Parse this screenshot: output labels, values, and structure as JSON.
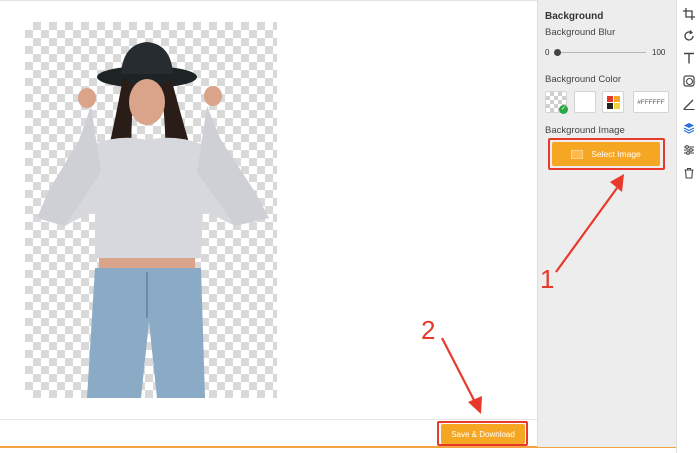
{
  "canvas": {
    "save_label": "Save & Download"
  },
  "panel": {
    "heading": "Background",
    "blur_label": "Background Blur",
    "blur_value": 0,
    "blur_min": "0",
    "blur_max": "100",
    "color_label": "Background Color",
    "hex_value": "#FFFFFF",
    "image_label": "Background Image",
    "select_image_label": "Select Image"
  },
  "toolbar": {
    "tools": [
      "crop-icon",
      "rotate-icon",
      "text-icon",
      "shape-icon",
      "draw-icon",
      "layers-icon",
      "adjust-icon",
      "trash-icon"
    ],
    "active": "layers-icon"
  },
  "annotations": {
    "step1": "1",
    "step2": "2"
  },
  "colors": {
    "accent": "#f5a623",
    "highlight": "#e8392c",
    "active_tool": "#2a6fdb"
  }
}
